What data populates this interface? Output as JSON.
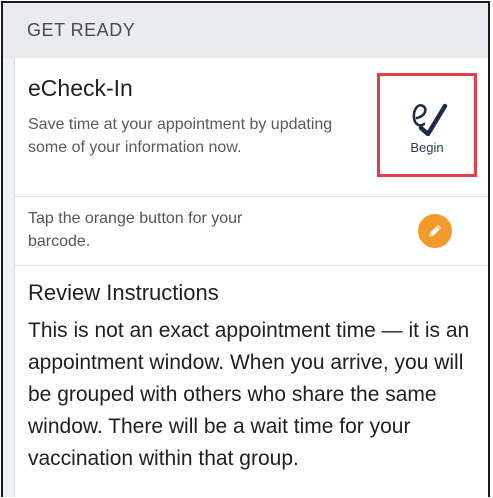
{
  "section": {
    "header": "GET READY"
  },
  "echeckin": {
    "title": "eCheck-In",
    "description": "Save time at your appointment by updating some of your information now.",
    "begin_label": "Begin",
    "begin_icon": "echeckin-icon",
    "highlight_color": "#e0414a"
  },
  "barcode": {
    "text": "Tap the orange button for your barcode.",
    "button_icon": "pencil-icon",
    "button_color": "#f39a2a"
  },
  "review": {
    "title": "Review Instructions",
    "body": "This is not an exact appointment time — it is an appointment window. When you arrive, you will be grouped with others who share the same window. There will be a wait time for your vaccination within that group."
  }
}
